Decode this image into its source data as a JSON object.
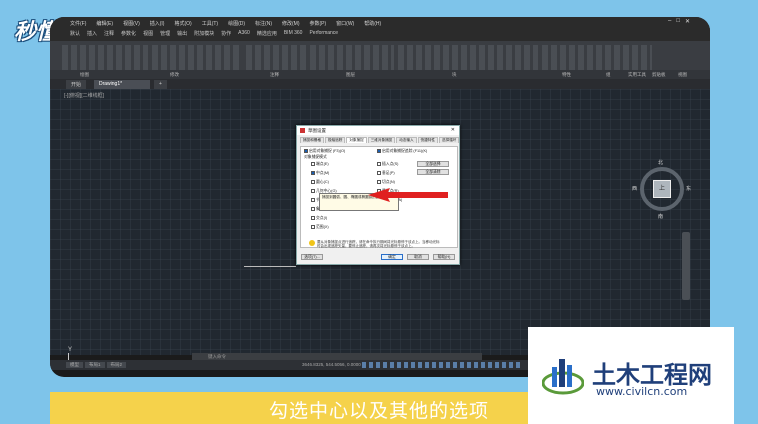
{
  "logo": {
    "text": "秒懂视频"
  },
  "menubar": {
    "items": [
      "文件(F)",
      "编辑(E)",
      "视图(V)",
      "插入(I)",
      "格式(O)",
      "工具(T)",
      "绘图(D)",
      "标注(N)",
      "修改(M)",
      "参数(P)",
      "窗口(W)",
      "帮助(H)"
    ],
    "ribbon_tabs": [
      "默认",
      "插入",
      "注释",
      "参数化",
      "视图",
      "管理",
      "输出",
      "附加模块",
      "协作",
      "A360",
      "精选应用",
      "BIM 360",
      "Performance"
    ]
  },
  "ribbon": {
    "panels": [
      "绘图",
      "修改",
      "注释",
      "图层",
      "块",
      "特性",
      "组",
      "实用工具",
      "剪贴板",
      "视图"
    ]
  },
  "file_tabs": [
    {
      "label": "开始",
      "active": false
    },
    {
      "label": "Drawing1*",
      "active": true
    }
  ],
  "drawing": {
    "view_label": "[-][俯视][二维线框]",
    "ucs_x": "X",
    "ucs_y": "Y"
  },
  "viewcube": {
    "face": "上",
    "north": "北",
    "south": "南",
    "east": "东",
    "west": "西"
  },
  "command_line": {
    "placeholder": "键入命令"
  },
  "status_bar": {
    "layout_tabs": [
      "模型",
      "布局1",
      "布局2"
    ],
    "coords": "3646.8325, 544.5056, 0.0000",
    "model_label": "模型"
  },
  "dialog": {
    "title": "草图设置",
    "tabs": [
      {
        "label": "捕捉和栅格",
        "active": false
      },
      {
        "label": "极轴追踪",
        "active": false
      },
      {
        "label": "对象捕捉",
        "active": true
      },
      {
        "label": "三维对象捕捉",
        "active": false
      },
      {
        "label": "动态输入",
        "active": false
      },
      {
        "label": "快捷特性",
        "active": false
      },
      {
        "label": "选择循环",
        "active": false
      }
    ],
    "enable_osnap": "启用对象捕捉 (F3)(O)",
    "enable_tracking": "启用对象捕捉追踪 (F11)(K)",
    "mode_header": "对象捕捉模式",
    "left_modes": [
      {
        "label": "端点(E)",
        "checked": false
      },
      {
        "label": "中点(M)",
        "checked": true
      },
      {
        "label": "圆心(C)",
        "checked": false
      },
      {
        "label": "几何中心(G)",
        "checked": false
      },
      {
        "label": "节点(D)",
        "checked": false
      },
      {
        "label": "象限点(Q)",
        "checked": false
      },
      {
        "label": "交点(I)",
        "checked": false
      },
      {
        "label": "范围(X)",
        "checked": false
      }
    ],
    "right_modes": [
      {
        "label": "插入点(S)",
        "checked": false
      },
      {
        "label": "垂足(P)",
        "checked": false
      },
      {
        "label": "切点(N)",
        "checked": false
      },
      {
        "label": "最近点(R)",
        "checked": false
      },
      {
        "label": "外观交点(A)",
        "checked": false
      },
      {
        "label": "平行线(L)",
        "checked": false
      }
    ],
    "select_all": "全部选择",
    "clear_all": "全部清除",
    "tooltip": "捕捉到圆弧、圆、椭圆或椭圆弧的圆心",
    "warning": "要从对象捕捉点进行追踪，请在命令执行期间将光标悬停于该点上。当移动光标时会出现追踪矢量，要停止追踪，请再次将光标悬停于该点上。",
    "options_button": "选项(T)...",
    "ok_button": "确定",
    "cancel_button": "取消",
    "help_button": "帮助(H)"
  },
  "caption": "勾选中心以及其他的选项",
  "watermark": {
    "name": "土木工程网",
    "url": "www.civilcn.com"
  },
  "colors": {
    "background": "#7ec4ea",
    "caption_band": "#f5d24b",
    "arrow": "#e02020",
    "watermark_text": "#1f3f7a"
  }
}
